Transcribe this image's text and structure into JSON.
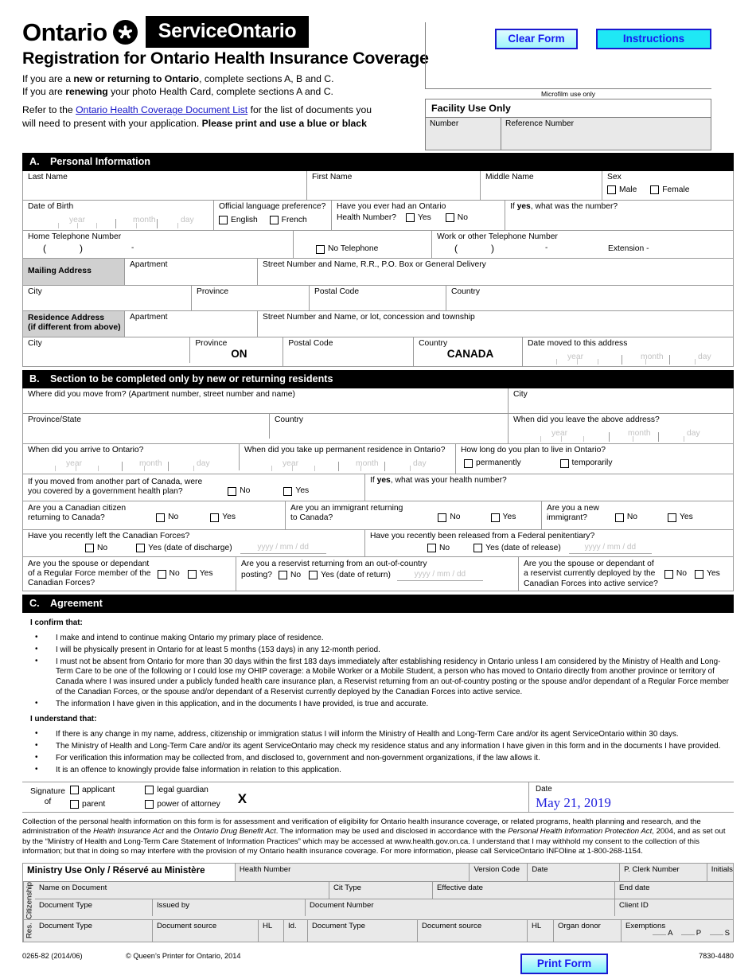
{
  "header": {
    "ontario_word": "Ontario",
    "trillium_icon": "trillium-icon",
    "service_ontario": "ServiceOntario",
    "title": "Registration for Ontario Health Insurance Coverage",
    "lead_line1_a": "If you are a ",
    "lead_line1_b": "new or returning to Ontario",
    "lead_line1_c": ", complete sections A, B and C.",
    "lead_line2_a": "If you are ",
    "lead_line2_b": "renewing",
    "lead_line2_c": " your photo Health Card, complete sections A and C.",
    "lead_line3_a": "Refer to the ",
    "lead_link": "Ontario Health Coverage Document List",
    "lead_line3_b": " for the list of documents you",
    "lead_line4_a": "will need to present with your application.  ",
    "lead_line4_b": "Please print and use a blue or black",
    "clear_form": "Clear Form",
    "instructions": "Instructions",
    "microfilm": "Microfilm use only",
    "facility_title": "Facility Use Only",
    "facility_number": "Number",
    "facility_reference": "Reference Number"
  },
  "section_a": {
    "letter": "A.",
    "title": "Personal Information",
    "last_name": "Last Name",
    "first_name": "First Name",
    "middle_name": "Middle Name",
    "sex": "Sex",
    "male": "Male",
    "female": "Female",
    "date_of_birth": "Date of Birth",
    "year": "year",
    "month": "month",
    "day": "day",
    "official_language": "Official language preference?",
    "english": "English",
    "french": "French",
    "ever_had_ohip_l1": "Have you ever had an Ontario",
    "ever_had_ohip_l2": "Health Number?",
    "yes": "Yes",
    "no": "No",
    "if_yes_number_a": "If ",
    "if_yes_number_b": "yes",
    "if_yes_number_c": ", what was the number?",
    "home_phone": "Home Telephone Number",
    "no_telephone": "No Telephone",
    "work_phone": "Work or other Telephone Number",
    "extension": "Extension -",
    "paren_open": "(",
    "paren_close": ")",
    "dash": "-",
    "mailing_address": "Mailing Address",
    "apartment": "Apartment",
    "street_mailing": "Street Number and Name, R.R., P.O. Box or General Delivery",
    "city": "City",
    "province": "Province",
    "postal_code": "Postal Code",
    "country": "Country",
    "residence_address_l1": "Residence Address",
    "residence_address_l2": "(if different from above)",
    "street_residence": "Street Number and Name, or lot, concession and township",
    "province_value": "ON",
    "country_value": "CANADA",
    "date_moved": "Date moved to this address"
  },
  "section_b": {
    "letter": "B.",
    "title": "Section to be completed only by new or returning residents",
    "where_move_from": "Where did you move from? (Apartment number, street number and name)",
    "city": "City",
    "province_state": "Province/State",
    "country": "Country",
    "when_leave": "When did you leave the above address?",
    "when_arrive": "When did you arrive to Ontario?",
    "when_permanent": "When did you take up permanent residence in Ontario?",
    "how_long": "How long do you plan to live in Ontario?",
    "permanently": "permanently",
    "temporarily": "temporarily",
    "year": "year",
    "month": "month",
    "day": "day",
    "moved_canada_l1": "If you moved from another part of Canada, were",
    "moved_canada_l2": "you covered by a government health plan?",
    "if_yes_health_a": "If ",
    "if_yes_health_b": "yes",
    "if_yes_health_c": ", what was your health number?",
    "citizen_l1": "Are you a Canadian citizen",
    "citizen_l2": "returning to Canada?",
    "immigrant_ret_l1": "Are you an immigrant returning",
    "immigrant_ret_l2": "to Canada?",
    "new_immigrant_l1": "Are you a new",
    "new_immigrant_l2": "immigrant?",
    "left_forces": "Have you recently left the Canadian Forces?",
    "yes_discharge": "Yes (date of discharge)",
    "released_pen": "Have you recently been released from a Federal penitentiary?",
    "yes_release": "Yes (date of release)",
    "spouse_regular_l1": "Are you the spouse or dependant",
    "spouse_regular_l2": "of a Regular Force member of the",
    "spouse_regular_l3": "Canadian Forces?",
    "reservist_l1": "Are you a reservist returning from an out-of-country",
    "reservist_l2": "posting?",
    "yes_return": "Yes (date of return)",
    "spouse_reservist_l1": "Are you the spouse or dependant of",
    "spouse_reservist_l2": "a reservist currently deployed by the",
    "spouse_reservist_l3": "Canadian Forces into active service?",
    "yes": "Yes",
    "no": "No",
    "date_ph": "yyyy / mm / dd"
  },
  "section_c": {
    "letter": "C.",
    "title": "Agreement",
    "confirm_head": "I confirm that:",
    "confirm_items": [
      "I make and intend to continue making Ontario my primary place of residence.",
      "I will be physically present in Ontario for at least 5 months (153 days) in any 12-month period.",
      "I must not be absent from Ontario for more than 30 days within the first 183 days immediately after establishing residency in Ontario unless I am considered by the Ministry of Health and Long-Term Care to be one of the following or I could lose my OHIP coverage: a Mobile Worker or a Mobile Student, a person who has moved to Ontario directly from another province or territory of Canada where I was insured under a publicly funded health care insurance plan, a Reservist returning from an out-of-country posting or the spouse and/or dependant of a Regular Force member of the Canadian Forces, or the spouse and/or dependant of a Reservist currently deployed by the Canadian Forces into active service.",
      "The information I have given in this application, and in the documents I have provided, is true and accurate."
    ],
    "understand_head": "I understand that:",
    "understand_items": [
      "If there is any change in my name, address, citizenship or immigration status I will inform the Ministry of Health and Long-Term Care and/or its agent ServiceOntario within 30 days.",
      "The Ministry of Health and Long-Term Care and/or its agent ServiceOntario may check my residence status and any information I have given in this form and in the documents I have provided.",
      "For verification this information may be collected from, and disclosed to, government and non-government organizations, if the law allows it.",
      "It is an offence to knowingly provide false information in relation to this application."
    ]
  },
  "signature": {
    "signature_l1": "Signature",
    "signature_l2": "of",
    "applicant": "applicant",
    "parent": "parent",
    "legal_guardian": "legal guardian",
    "power_of_attorney": "power of attorney",
    "x_mark": "X",
    "date_label": "Date",
    "date_value": "May 21, 2019",
    "date_color": "#2222dd"
  },
  "privacy": {
    "p1": "Collection of the personal health information on this form is for assessment and verification of eligibility for Ontario health insurance coverage, or related programs, health planning and research, and the administration of the ",
    "i1": "Health Insurance Act",
    "p2": " and the ",
    "i2": "Ontario Drug Benefit Act",
    "p3": ".  The information may be used and disclosed in accordance with the ",
    "i3": "Personal Health Information Protection Act",
    "p4": ", 2004, and as set out by the “Ministry of Health and Long-Term Care Statement of Information Practices” which may be accessed at www.health.gov.on.ca.  I understand that I may withhold my consent to the collection of this information; but that in doing so may interfere with the provision of my Ontario health insurance coverage.  For more information, please call ServiceOntario INFOline at 1-800-268-1154."
  },
  "ministry": {
    "title": "Ministry Use Only / Réservé au Ministère",
    "health_number": "Health Number",
    "version_code": "Version Code",
    "date": "Date",
    "clerk_number": "P. Clerk Number",
    "initials": "Initials",
    "citizenship": "Citizenship",
    "res": "Res.",
    "name_on_document": "Name on Document",
    "cit_type": "Cit Type",
    "effective_date": "Effective date",
    "end_date": "End date",
    "document_type": "Document Type",
    "issued_by": "Issued by",
    "document_number": "Document Number",
    "client_id": "Client ID",
    "document_source": "Document source",
    "hl": "HL",
    "id": "Id.",
    "organ_donor": "Organ donor",
    "exemptions": "Exemptions",
    "ex_a": "A",
    "ex_p": "P",
    "ex_s": "S"
  },
  "footer": {
    "form_code": "0265-82 (2014/06)",
    "copyright": "© Queen’s Printer for Ontario, 2014",
    "doc_number": "7830-4480",
    "print_form": "Print Form"
  }
}
